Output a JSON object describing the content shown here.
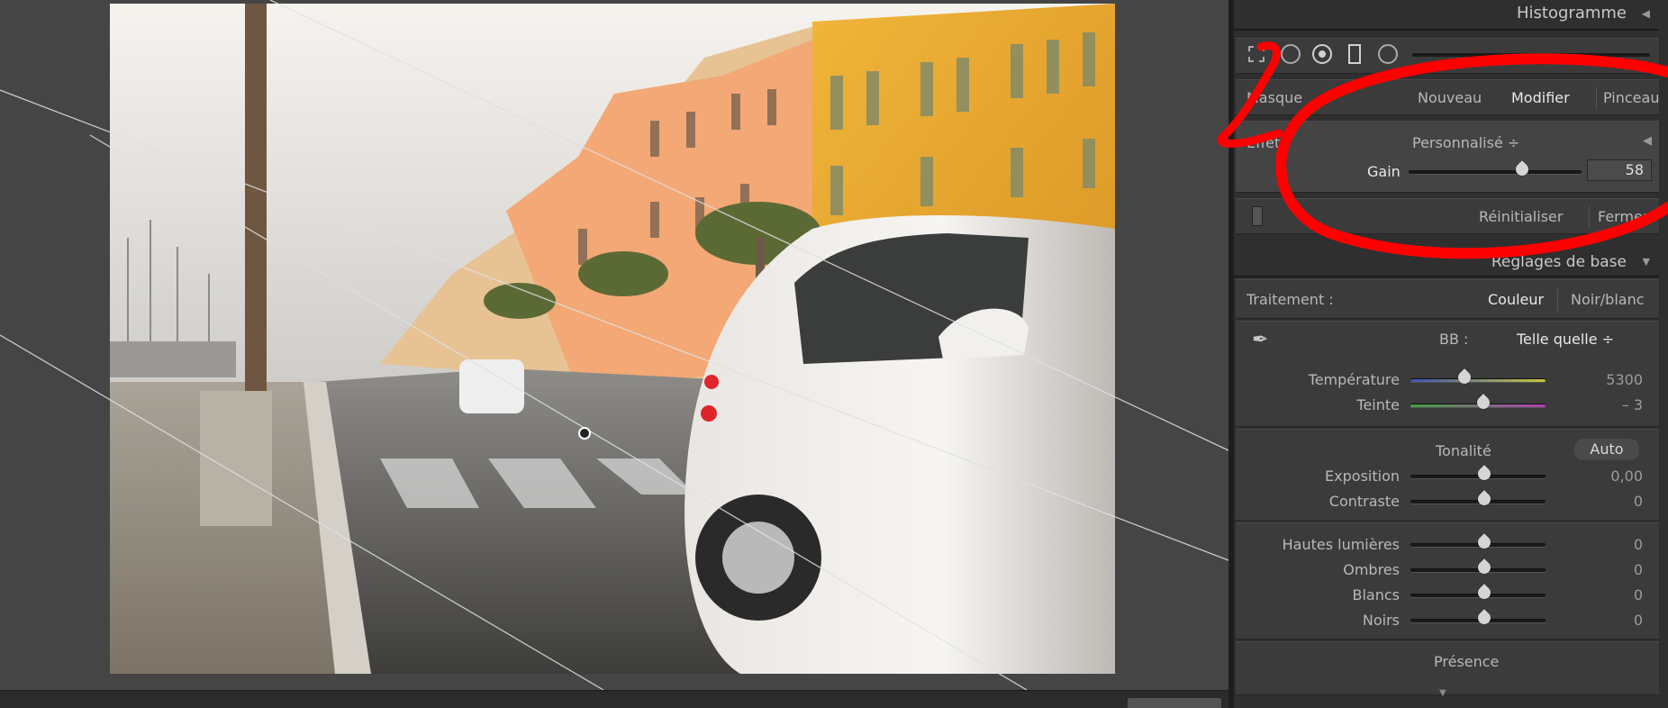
{
  "canvas": {
    "photo_description_icon": "photo-street-scene"
  },
  "panel": {
    "histogram_title": "Histogramme",
    "mask": {
      "label": "Masque",
      "new_label": "Nouveau",
      "edit_label": "Modifier",
      "brush_label": "Pinceau"
    },
    "effect": {
      "label": "Effet :",
      "preset_label": "Personnalisé ÷",
      "gain_label": "Gain",
      "gain_value": "58",
      "gain_fraction": 0.62
    },
    "footer": {
      "reset_label": "Réinitialiser",
      "close_label": "Fermer"
    },
    "basic": {
      "title": "Réglages de base",
      "treatment_label": "Traitement :",
      "color_label": "Couleur",
      "bw_label": "Noir/blanc",
      "wb_label": "BB :",
      "wb_value": "Telle quelle ÷",
      "temperature_label": "Température",
      "temperature_value": "5300",
      "temperature_fraction": 0.35,
      "tint_label": "Teinte",
      "tint_value": "– 3",
      "tint_fraction": 0.49,
      "tone_label": "Tonalité",
      "auto_label": "Auto",
      "exposure_label": "Exposition",
      "exposure_value": "0,00",
      "contrast_label": "Contraste",
      "contrast_value": "0",
      "highlights_label": "Hautes lumières",
      "highlights_value": "0",
      "shadows_label": "Ombres",
      "shadows_value": "0",
      "whites_label": "Blancs",
      "whites_value": "0",
      "blacks_label": "Noirs",
      "blacks_value": "0",
      "presence_label": "Présence"
    }
  },
  "colors": {
    "annotation_red": "#ff0000",
    "panel_bg": "#2f2f2f",
    "section_bg": "#3b3b3b"
  }
}
